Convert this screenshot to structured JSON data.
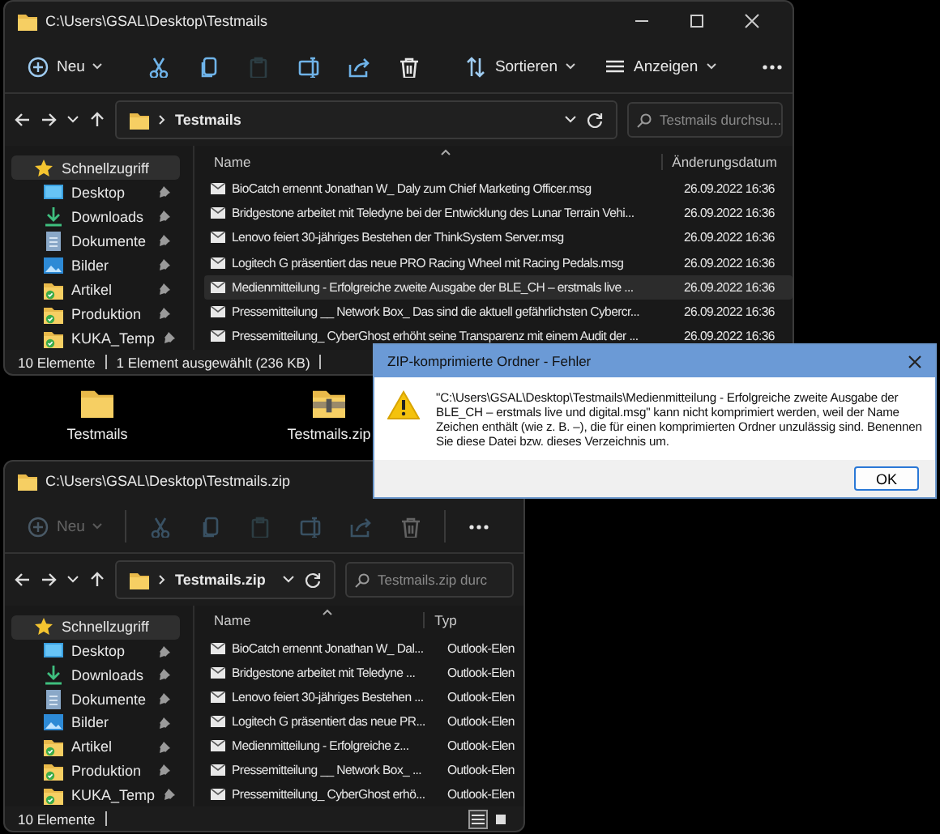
{
  "windows": [
    {
      "title": "C:\\Users\\GSAL\\Desktop\\Testmails",
      "caption_buttons": true,
      "toolbar": [
        {
          "kind": "new",
          "label": "Neu",
          "disabled": false
        },
        {
          "kind": "cut",
          "disabled": false
        },
        {
          "kind": "copy",
          "disabled": false
        },
        {
          "kind": "paste",
          "disabled": true
        },
        {
          "kind": "rename",
          "disabled": false
        },
        {
          "kind": "share",
          "disabled": false
        },
        {
          "kind": "delete",
          "disabled": false
        },
        {
          "kind": "sort",
          "label": "Sortieren",
          "disabled": false
        },
        {
          "kind": "view",
          "label": "Anzeigen",
          "disabled": false
        },
        {
          "kind": "more",
          "disabled": false
        }
      ],
      "address": {
        "folder": "Testmails"
      },
      "search": {
        "placeholder": "Testmails durchsu..."
      },
      "sidebar": [
        {
          "kind": "star",
          "label": "Schnellzugriff",
          "selected": true,
          "pinned": false
        },
        {
          "kind": "desktop",
          "label": "Desktop",
          "selected": false,
          "pinned": true
        },
        {
          "kind": "download",
          "label": "Downloads",
          "selected": false,
          "pinned": true
        },
        {
          "kind": "document",
          "label": "Dokumente",
          "selected": false,
          "pinned": true
        },
        {
          "kind": "picture",
          "label": "Bilder",
          "selected": false,
          "pinned": true
        },
        {
          "kind": "folder",
          "label": "Artikel",
          "selected": false,
          "pinned": true
        },
        {
          "kind": "folder",
          "label": "Produktion",
          "selected": false,
          "pinned": true
        },
        {
          "kind": "folder",
          "label": "KUKA_Temp",
          "selected": false,
          "pinned": true
        }
      ],
      "columns": [
        "Name",
        "Änderungsdatum"
      ],
      "rows": [
        {
          "cells": [
            "BioCatch ernennt Jonathan W_ Daly zum Chief Marketing Officer.msg",
            "26.09.2022 16:36"
          ],
          "selected": false
        },
        {
          "cells": [
            "Bridgestone arbeitet mit Teledyne bei der Entwicklung des Lunar Terrain Vehi...",
            "26.09.2022 16:36"
          ],
          "selected": false
        },
        {
          "cells": [
            "Lenovo feiert 30-jähriges Bestehen der ThinkSystem Server.msg",
            "26.09.2022 16:36"
          ],
          "selected": false
        },
        {
          "cells": [
            "Logitech G präsentiert das neue PRO Racing Wheel mit Racing Pedals.msg",
            "26.09.2022 16:36"
          ],
          "selected": false
        },
        {
          "cells": [
            "Medienmitteilung - Erfolgreiche zweite Ausgabe der BLE_CH – erstmals live ...",
            "26.09.2022 16:36"
          ],
          "selected": true
        },
        {
          "cells": [
            "Pressemitteilung __ Network Box_ Das sind die aktuell gefährlichsten Cybercr...",
            "26.09.2022 16:36"
          ],
          "selected": false
        },
        {
          "cells": [
            "Pressemitteilung_ CyberGhost erhöht seine Transparenz mit einem Audit der ...",
            "26.09.2022 16:36"
          ],
          "selected": false
        }
      ],
      "status": [
        "10 Elemente",
        "1 Element ausgewählt (236 KB)"
      ],
      "view_switch": false
    },
    {
      "title": "C:\\Users\\GSAL\\Desktop\\Testmails.zip",
      "caption_buttons": false,
      "toolbar": [
        {
          "kind": "new",
          "label": "Neu",
          "disabled": true
        },
        {
          "kind": "cut",
          "disabled": true
        },
        {
          "kind": "copy",
          "disabled": true
        },
        {
          "kind": "paste",
          "disabled": true
        },
        {
          "kind": "rename",
          "disabled": true
        },
        {
          "kind": "share",
          "disabled": true
        },
        {
          "kind": "delete",
          "disabled": true
        },
        {
          "kind": "more",
          "disabled": false
        }
      ],
      "address": {
        "folder": "Testmails.zip"
      },
      "search": {
        "placeholder": "Testmails.zip durc"
      },
      "sidebar": [
        {
          "kind": "star",
          "label": "Schnellzugriff",
          "selected": true,
          "pinned": false
        },
        {
          "kind": "desktop",
          "label": "Desktop",
          "selected": false,
          "pinned": true
        },
        {
          "kind": "download",
          "label": "Downloads",
          "selected": false,
          "pinned": true
        },
        {
          "kind": "document",
          "label": "Dokumente",
          "selected": false,
          "pinned": true
        },
        {
          "kind": "picture",
          "label": "Bilder",
          "selected": false,
          "pinned": true
        },
        {
          "kind": "folder",
          "label": "Artikel",
          "selected": false,
          "pinned": true
        },
        {
          "kind": "folder",
          "label": "Produktion",
          "selected": false,
          "pinned": true
        },
        {
          "kind": "folder",
          "label": "KUKA_Temp",
          "selected": false,
          "pinned": true
        }
      ],
      "columns": [
        "Name",
        "Typ"
      ],
      "rows": [
        {
          "cells": [
            "BioCatch ernennt Jonathan W_ Dal...",
            "Outlook-Elen"
          ],
          "selected": false
        },
        {
          "cells": [
            "Bridgestone arbeitet mit Teledyne ...",
            "Outlook-Elen"
          ],
          "selected": false
        },
        {
          "cells": [
            "Lenovo feiert 30-jähriges Bestehen ...",
            "Outlook-Elen"
          ],
          "selected": false
        },
        {
          "cells": [
            "Logitech G präsentiert das neue PR...",
            "Outlook-Elen"
          ],
          "selected": false
        },
        {
          "cells": [
            "Medienmitteilung - Erfolgreiche z...",
            "Outlook-Elen"
          ],
          "selected": false
        },
        {
          "cells": [
            "Pressemitteilung __ Network Box_ ...",
            "Outlook-Elen"
          ],
          "selected": false
        },
        {
          "cells": [
            "Pressemitteilung_ CyberGhost erhö...",
            "Outlook-Elen"
          ],
          "selected": false
        }
      ],
      "status": [
        "10 Elemente"
      ],
      "view_switch": true
    }
  ],
  "desktop_icons": [
    {
      "kind": "folder",
      "label": "Testmails"
    },
    {
      "kind": "zip",
      "label": "Testmails.zip"
    }
  ],
  "dialog": {
    "title": "ZIP-komprimierte Ordner - Fehler",
    "message": "\"C:\\Users\\GSAL\\Desktop\\Testmails\\Medienmitteilung - Erfolgreiche zweite Ausgabe der BLE_CH – erstmals live und digital.msg\" kann nicht komprimiert werden, weil der Name Zeichen enthält (wie z. B. –), die für einen komprimierten Ordner unzulässig sind. Benennen Sie diese Datei bzw. dieses Verzeichnis um.",
    "button": "OK"
  }
}
